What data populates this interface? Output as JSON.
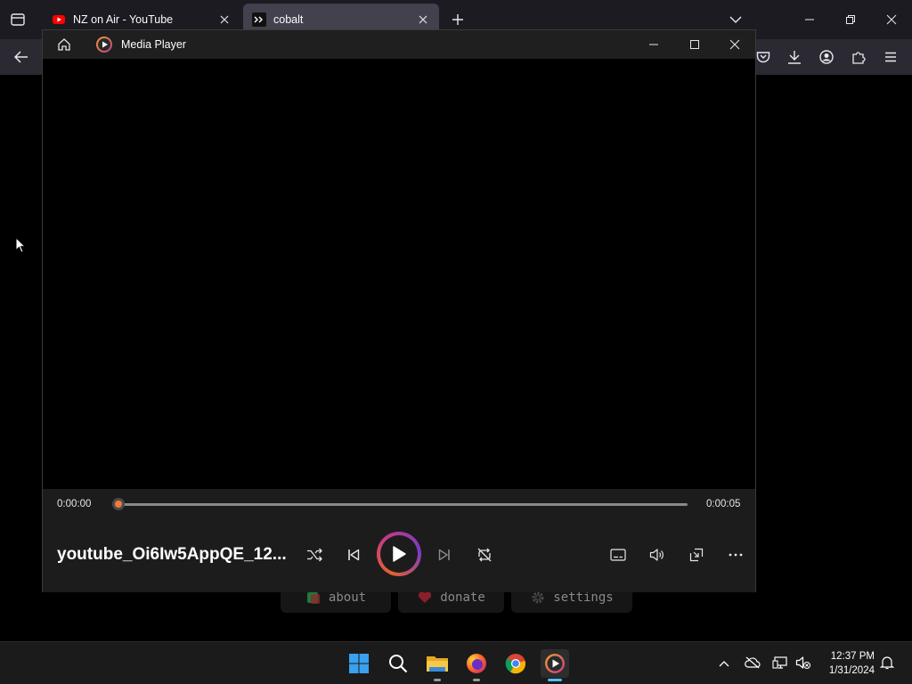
{
  "browser": {
    "tabs": [
      {
        "title": "NZ on Air - YouTube",
        "favicon": "youtube-icon",
        "active": false
      },
      {
        "title": "cobalt",
        "favicon": "cobalt-icon",
        "active": true
      }
    ]
  },
  "page": {
    "buttons": [
      {
        "label": "about",
        "icon": "about-icon"
      },
      {
        "label": "donate",
        "icon": "heart-icon"
      },
      {
        "label": "settings",
        "icon": "gear-icon"
      }
    ]
  },
  "player": {
    "app_title": "Media Player",
    "current_time": "0:00:00",
    "total_time": "0:00:05",
    "progress": 0.0,
    "media_title": "youtube_Oi6Iw5AppQE_12...",
    "accent_color": "#e2622f"
  },
  "taskbar": {
    "time": "12:37 PM",
    "date": "1/31/2024"
  }
}
